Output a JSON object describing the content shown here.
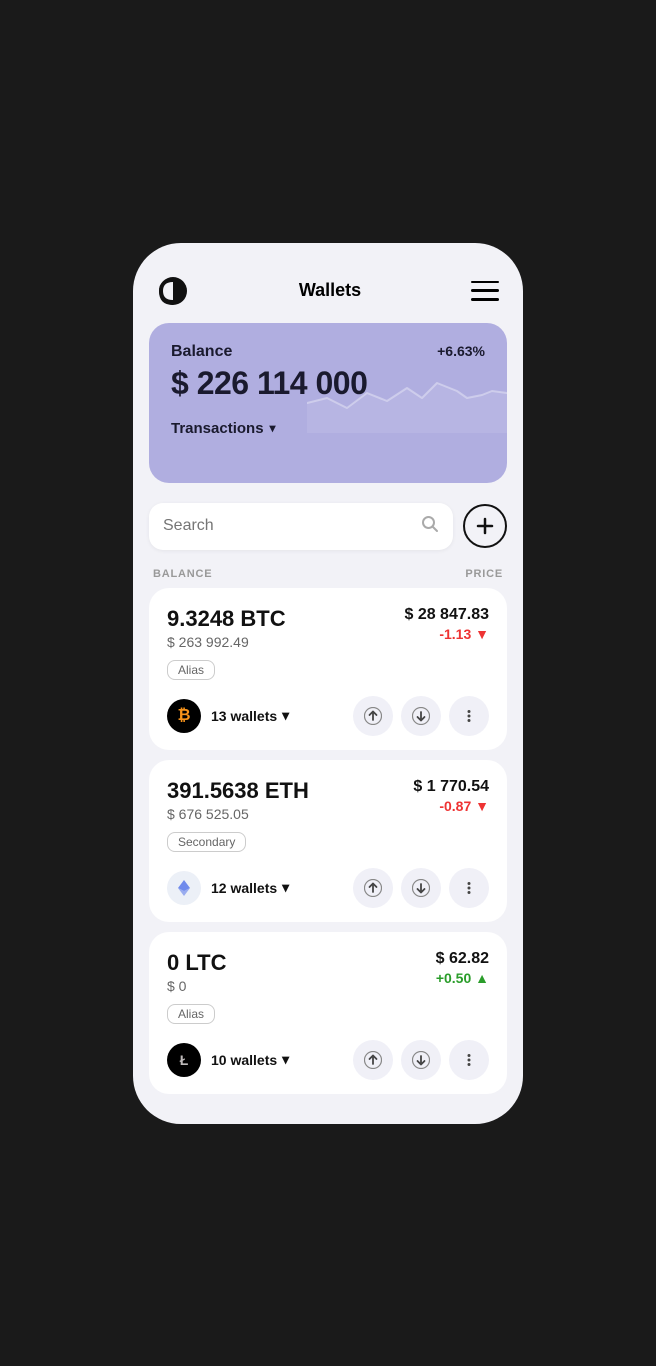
{
  "header": {
    "title": "Wallets",
    "menu_label": "menu"
  },
  "balance_card": {
    "label": "Balance",
    "percent": "+6.63%",
    "amount": "$ 226 114 000",
    "transactions_label": "Transactions"
  },
  "search": {
    "placeholder": "Search"
  },
  "add_button_label": "+",
  "columns": {
    "balance": "BALANCE",
    "price": "PRICE"
  },
  "coins": [
    {
      "id": "btc",
      "amount": "9.3248 BTC",
      "usd_value": "$ 263 992.49",
      "alias": "Alias",
      "logo_symbol": "₿",
      "logo_class": "btc-logo",
      "wallets_count": "13 wallets",
      "price": "$ 28 847.83",
      "change": "-1.13",
      "change_type": "neg",
      "change_icon": "▼"
    },
    {
      "id": "eth",
      "amount": "391.5638 ETH",
      "usd_value": "$ 676 525.05",
      "alias": "Secondary",
      "logo_symbol": "◆",
      "logo_class": "eth-logo",
      "wallets_count": "12 wallets",
      "price": "$ 1 770.54",
      "change": "-0.87",
      "change_type": "neg",
      "change_icon": "▼"
    },
    {
      "id": "ltc",
      "amount": "0 LTC",
      "usd_value": "$ 0",
      "alias": "Alias",
      "logo_symbol": "Ł",
      "logo_class": "ltc-logo",
      "wallets_count": "10 wallets",
      "price": "$ 62.82",
      "change": "+0.50",
      "change_type": "pos",
      "change_icon": "▲"
    }
  ],
  "colors": {
    "accent": "#b0aee0",
    "negative": "#e33333",
    "positive": "#2a9d2a"
  }
}
